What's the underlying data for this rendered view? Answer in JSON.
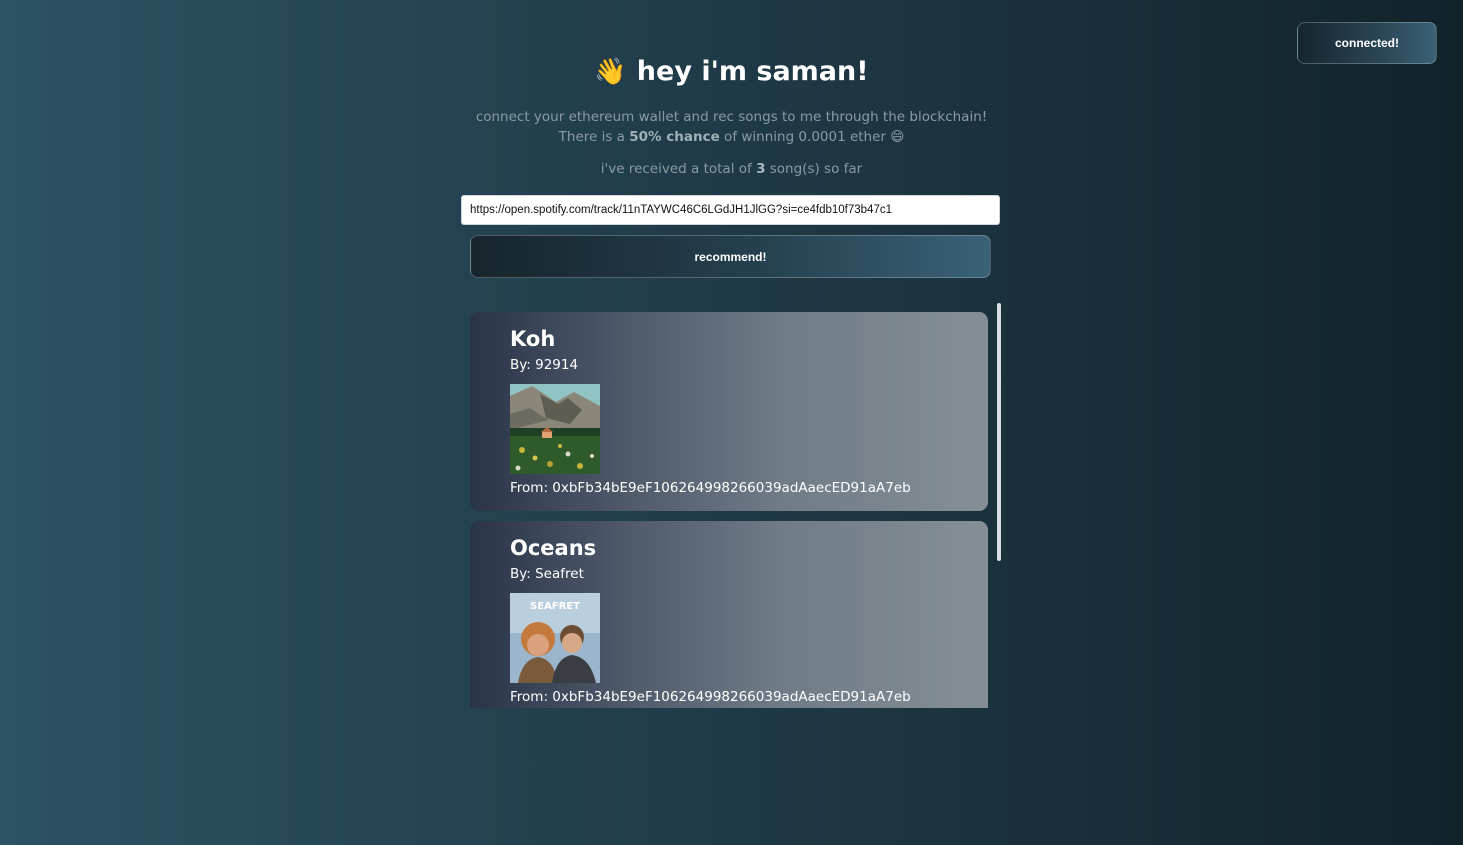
{
  "header": {
    "wave_emoji": "👋",
    "title": "hey i'm saman!",
    "bio_prefix": "connect your ethereum wallet and rec songs to me through the blockchain! There is a ",
    "bio_bold": "50% chance",
    "bio_suffix": " of winning 0.0001 ether ",
    "bio_emoji": "😄",
    "count_prefix": "i've received a total of ",
    "count_value": "3",
    "count_suffix": " song(s) so far"
  },
  "wallet": {
    "button_label": "connected!"
  },
  "form": {
    "input_value": "https://open.spotify.com/track/11nTAYWC46C6LGdJH1JlGG?si=ce4fdb10f73b47c1",
    "submit_label": "recommend!"
  },
  "songs": [
    {
      "title": "Koh",
      "artist": "By: 92914",
      "from": "From: 0xbFb34bE9eF106264998266039adAaecED91aA7eb",
      "cover_icon": "mountain-landscape-cover"
    },
    {
      "title": "Oceans",
      "artist": "By: Seafret",
      "from": "From: 0xbFb34bE9eF106264998266039adAaecED91aA7eb",
      "cover_text": "SEAFRET",
      "cover_icon": "band-portrait-cover"
    }
  ],
  "colors": {
    "bg_left": "#2d5264",
    "bg_right": "#12232a",
    "muted_text": "#8a9ba3"
  }
}
